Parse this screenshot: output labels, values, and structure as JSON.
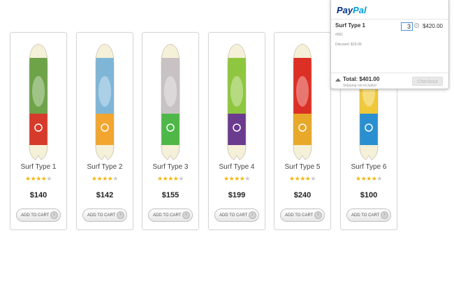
{
  "products": [
    {
      "name": "Surf Type 1",
      "price": "$140",
      "rating": 4,
      "max_rating": 5,
      "button": "ADD TO CART",
      "colors": [
        "#d63a2a",
        "#6ea348",
        "#f5f0d8"
      ]
    },
    {
      "name": "Surf Type 2",
      "price": "$142",
      "rating": 4,
      "max_rating": 5,
      "button": "ADD TO CART",
      "colors": [
        "#f2a630",
        "#7fb6d8",
        "#f5f0d8"
      ]
    },
    {
      "name": "Surf Type 3",
      "price": "$155",
      "rating": 4,
      "max_rating": 5,
      "button": "ADD TO CART",
      "colors": [
        "#4db848",
        "#c9c2c4",
        "#f5f0d8"
      ]
    },
    {
      "name": "Surf Type 4",
      "price": "$199",
      "rating": 4,
      "max_rating": 5,
      "button": "ADD TO CART",
      "colors": [
        "#6b3b8f",
        "#8ec73f",
        "#f5f0d8"
      ]
    },
    {
      "name": "Surf Type 5",
      "price": "$240",
      "rating": 4,
      "max_rating": 5,
      "button": "ADD TO CART",
      "colors": [
        "#e8a82a",
        "#dc2f25",
        "#f5f0d8"
      ]
    },
    {
      "name": "Surf Type 6",
      "price": "$100",
      "rating": 4,
      "max_rating": 5,
      "button": "ADD TO CART",
      "colors": [
        "#2a8fd0",
        "#f0c93a",
        "#f5f0d8"
      ]
    }
  ],
  "cart": {
    "logo_pay": "Pay",
    "logo_pal": "Pal",
    "item": {
      "name": "Surf Type 1",
      "number": "#001",
      "discount": "Discount: $19.00",
      "quantity": "3",
      "amount": "$420.00"
    },
    "total": "Total: $401.00",
    "shipping_note": "Shipping not included",
    "checkout_label": "Checkout",
    "remove_icon": "close-icon"
  }
}
